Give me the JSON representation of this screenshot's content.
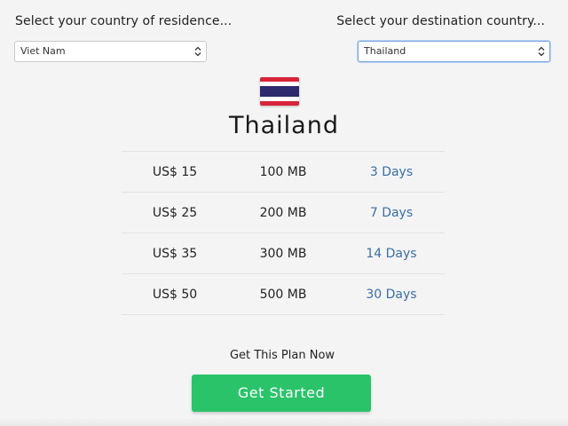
{
  "residence": {
    "label": "Select your country of residence...",
    "selected": "Viet Nam"
  },
  "destination": {
    "label": "Select your destination country...",
    "selected": "Thailand"
  },
  "flag": {
    "country": "Thailand",
    "colors": [
      "#d8243a",
      "#ffffff",
      "#2d2a6e",
      "#ffffff",
      "#d8243a"
    ]
  },
  "country_title": "Thailand",
  "plans": [
    {
      "price": "US$ 15",
      "data": "100 MB",
      "days": "3 Days"
    },
    {
      "price": "US$ 25",
      "data": "200 MB",
      "days": "7 Days"
    },
    {
      "price": "US$ 35",
      "data": "300 MB",
      "days": "14 Days"
    },
    {
      "price": "US$ 50",
      "data": "500 MB",
      "days": "30 Days"
    }
  ],
  "cta": {
    "text": "Get This Plan Now",
    "button_label": "Get Started",
    "button_color": "#2ac36a"
  },
  "colors": {
    "background": "#f4f4f4",
    "days_link": "#3a6ea5"
  }
}
